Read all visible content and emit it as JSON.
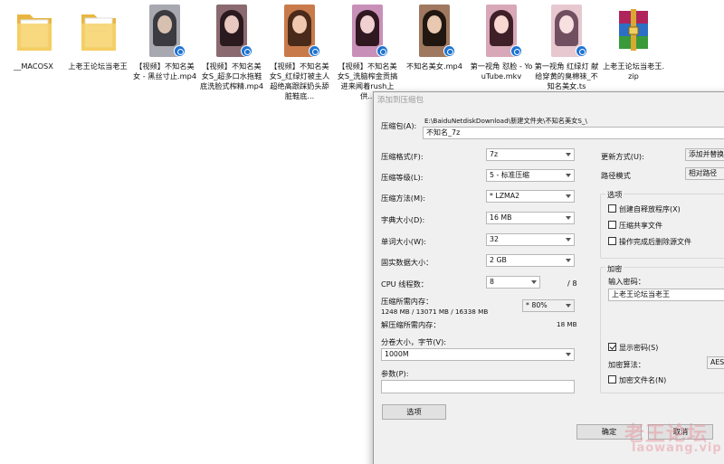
{
  "files": [
    {
      "type": "folder",
      "label": "__MACOSX"
    },
    {
      "type": "folder",
      "label": "上老王论坛当老王"
    },
    {
      "type": "video",
      "label": "【视频】不知名美女 - 黑丝寸止.mp4",
      "colors": [
        "#a8a8b0",
        "#3a3a40",
        "#d8c0b0"
      ]
    },
    {
      "type": "video",
      "label": "【视频】不知名美女S_超多口水拖鞋底洗脸式榨精.mp4",
      "colors": [
        "#8a6a70",
        "#2a1a20",
        "#e8c8c0"
      ]
    },
    {
      "type": "video",
      "label": "【视频】不知名美女S_红绿灯被主人超绝高跟踩奶头舔脏鞋底...",
      "colors": [
        "#c87a4a",
        "#4a2a1a",
        "#f0c8b0"
      ]
    },
    {
      "type": "video",
      "label": "【视频】不知名美女S_洗脑榨金贡搞进来闻着rush上供...",
      "colors": [
        "#c890b8",
        "#301820",
        "#f0d0d0"
      ]
    },
    {
      "type": "video",
      "label": "不知名美女.mp4",
      "colors": [
        "#a07860",
        "#201810",
        "#e8c8b0"
      ]
    },
    {
      "type": "video",
      "label": "第一视角 怼脸 - YouTube.mkv",
      "colors": [
        "#d8a8b8",
        "#402028",
        "#f8d8d0"
      ]
    },
    {
      "type": "video",
      "label": "第一视角 红绿灯 献给穿黄的臭棉袜_不知名美女.ts",
      "colors": [
        "#e8c8d0",
        "#705060",
        "#f8e0e0"
      ]
    },
    {
      "type": "archive",
      "label": "上老王论坛当老王.zip"
    }
  ],
  "dialog": {
    "title": "添加到压缩包",
    "archive_label": "压缩包(A):",
    "archive_path": "E:\\BaiduNetdiskDownload\\新建文件夹\\不知名美女S_\\",
    "archive_name": "不知名_7z",
    "format_label": "压缩格式(F):",
    "format_value": "7z",
    "level_label": "压缩等级(L):",
    "level_value": "5 - 标准压缩",
    "method_label": "压缩方法(M):",
    "method_value": "* LZMA2",
    "dict_label": "字典大小(D):",
    "dict_value": "16 MB",
    "word_label": "单词大小(W):",
    "word_value": "32",
    "solid_label": "固实数据大小：",
    "solid_value": "2 GB",
    "cpu_label": "CPU 线程数：",
    "cpu_value": "8",
    "cpu_total": "/ 8",
    "mem_comp_label": "压缩所需内存：",
    "mem_comp_value": "1248 MB / 13071 MB / 16338 MB",
    "mem_percent": "* 80%",
    "mem_decomp_label": "解压缩所需内存：",
    "mem_decomp_value": "18 MB",
    "split_label": "分卷大小，字节(V):",
    "split_value": "1000M",
    "params_label": "参数(P):",
    "params_value": "",
    "options_button": "选项",
    "update_label": "更新方式(U):",
    "update_value": "添加并替换",
    "path_label": "路径模式",
    "path_value": "相对路径",
    "options_group": "选项",
    "opt_sfx": "创建自释放程序(X)",
    "opt_shared": "压缩共享文件",
    "opt_delete": "操作完成后删除源文件",
    "encrypt_group": "加密",
    "password_label": "输入密码：",
    "password_value": "上老王论坛当老王",
    "show_password": "显示密码(S)",
    "encrypt_method_label": "加密算法：",
    "encrypt_method_value": "AES",
    "encrypt_names": "加密文件名(N)",
    "ok_button": "确定",
    "cancel_button": "取消"
  },
  "watermark": {
    "line1": "老王论坛",
    "line2": "laowang.vip"
  }
}
